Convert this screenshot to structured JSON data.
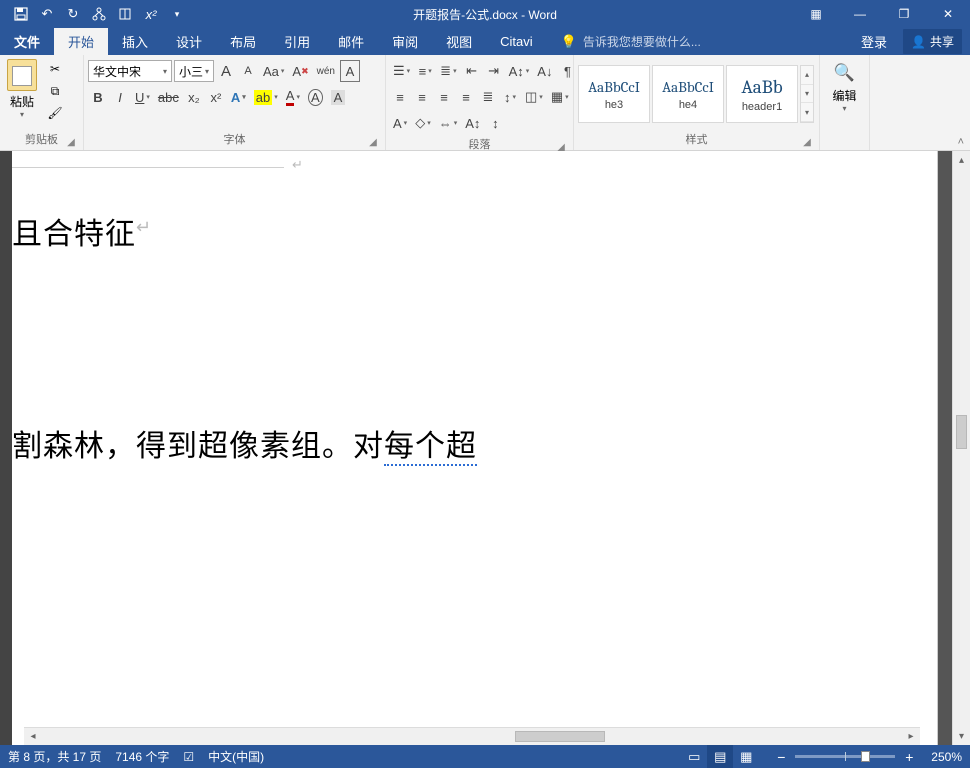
{
  "title": "开题报告-公式.docx - Word",
  "qat": {
    "save": "save",
    "undo": "undo",
    "redo": "redo",
    "hierarchy": "hier",
    "layout": "page-layout",
    "superscript": "x²",
    "more": "▾"
  },
  "window": {
    "ribbon_opts": "▦",
    "min": "—",
    "restore": "❐",
    "close": "✕"
  },
  "tabs": {
    "file": "文件",
    "home": "开始",
    "insert": "插入",
    "design": "设计",
    "layout": "布局",
    "references": "引用",
    "mailings": "邮件",
    "review": "审阅",
    "view": "视图",
    "citavi": "Citavi"
  },
  "tell_me_placeholder": "告诉我您想要做什么...",
  "login": "登录",
  "share": "共享",
  "groups": {
    "clipboard": "剪贴板",
    "font": "字体",
    "paragraph": "段落",
    "styles": "样式",
    "editing": "编辑"
  },
  "clipboard": {
    "paste": "粘贴"
  },
  "font": {
    "name": "华文中宋",
    "size": "小三",
    "grow": "A",
    "shrink": "A",
    "case": "Aa",
    "clear": "⌫",
    "phonetic": "wén",
    "charborder": "A",
    "bold": "B",
    "italic": "I",
    "underline": "U",
    "strike": "abc",
    "sub": "x₂",
    "sup": "x²",
    "texteffect": "A",
    "highlight": "ab",
    "fontcolor": "A",
    "circled": "A",
    "charshade": "A"
  },
  "paragraph": {
    "bullets": "•",
    "numbers": "1.",
    "multilist": "i.",
    "dec_indent": "⇤",
    "inc_indent": "⇥",
    "sort": "A↓",
    "showmarks": "¶",
    "align_l": "≡",
    "align_c": "≡",
    "align_r": "≡",
    "align_j": "≡",
    "align_d": "≣",
    "linespace": "↕",
    "shading": "▢",
    "borders": "▦",
    "textdir": "A↕",
    "asian": "◇"
  },
  "styles": {
    "s1": {
      "preview": "AaBbCcI",
      "name": "he3"
    },
    "s2": {
      "preview": "AaBbCcI",
      "name": "he4"
    },
    "s3": {
      "preview": "AaBb",
      "name": "header1"
    }
  },
  "editing": {
    "label": "编辑"
  },
  "document": {
    "line1_a": "且合特征",
    "line2_a": "割森林，得到超像素组。对",
    "line2_b": "每个超"
  },
  "status": {
    "page": "第 8 页，共 17 页",
    "words": "7146 个字",
    "proof_icon": "☑",
    "lang": "中文(中国)",
    "zoom": "250%"
  }
}
